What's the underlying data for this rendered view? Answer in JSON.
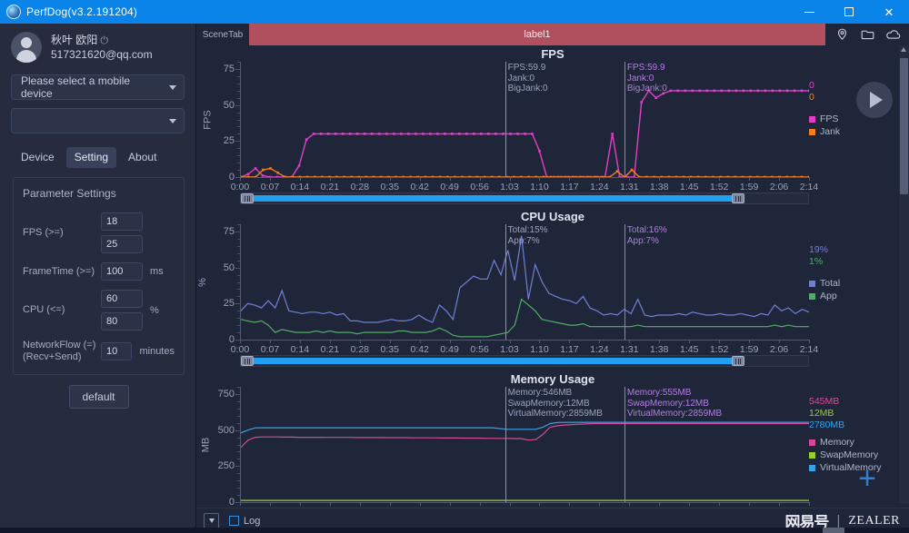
{
  "window": {
    "title": "PerfDog(v3.2.191204)",
    "app_icon": "perfdog-logo",
    "minimize": "–",
    "maximize": "▢",
    "close": "✕"
  },
  "sidebar": {
    "user": {
      "name": "秋叶 欧阳",
      "power_icon": "⏻",
      "email": "517321620@qq.com"
    },
    "device_select": {
      "value": "Please select a mobile device",
      "caret_icon": "chevron-down-icon"
    },
    "secondary_select": {
      "value": "",
      "caret_icon": "chevron-down-icon"
    },
    "tabs": [
      {
        "label": "Device",
        "active": false
      },
      {
        "label": "Setting",
        "active": true
      },
      {
        "label": "About",
        "active": false
      }
    ],
    "settings": {
      "title": "Parameter Settings",
      "fields": [
        {
          "label": "FPS (>=)",
          "values": [
            "18",
            "25"
          ],
          "unit": ""
        },
        {
          "label": "FrameTime (>=)",
          "values": [
            "100"
          ],
          "unit": "ms"
        },
        {
          "label": "CPU (<=)",
          "values": [
            "60",
            "80"
          ],
          "unit": "%"
        },
        {
          "label": "NetworkFlow (=)\n(Recv+Send)",
          "values": [
            "10"
          ],
          "unit": "minutes"
        }
      ],
      "default_button": "default"
    }
  },
  "scenebar": {
    "scene_tab": "SceneTab",
    "label": "label1",
    "icons": [
      "location-pin-icon",
      "folder-icon",
      "cloud-icon"
    ]
  },
  "bottom": {
    "dropdown_icon": "dropdown-icon",
    "log_label": "Log",
    "watermark_cn": "网易号",
    "watermark_sep": "|",
    "watermark_en": "ZEALER"
  },
  "controls": {
    "play_icon": "play-icon",
    "add_icon": "+"
  },
  "axis": {
    "xlabels": [
      "0:00",
      "0:07",
      "0:14",
      "0:21",
      "0:28",
      "0:35",
      "0:42",
      "0:49",
      "0:56",
      "1:03",
      "1:10",
      "1:17",
      "1:24",
      "1:31",
      "1:38",
      "1:45",
      "1:52",
      "1:59",
      "2:06",
      "2:14"
    ]
  },
  "chart_data": [
    {
      "type": "line",
      "title": "FPS",
      "xlabel": "",
      "ylabel": "FPS",
      "ylim": [
        0,
        80
      ],
      "yticks": [
        0,
        25,
        50,
        75
      ],
      "x": [
        "0:00",
        "2:14"
      ],
      "grid": false,
      "legend_position": "right",
      "series": [
        {
          "name": "FPS",
          "color": "#e040c8",
          "current": "0",
          "values": [
            0,
            2,
            6,
            1,
            0,
            0,
            0,
            0,
            8,
            26,
            30,
            30,
            30,
            30,
            30,
            30,
            30,
            30,
            30,
            30,
            30,
            30,
            30,
            30,
            30,
            30,
            30,
            30,
            30,
            30,
            30,
            30,
            30,
            30,
            30,
            30,
            30,
            30,
            30,
            30,
            30,
            18,
            0,
            0,
            0,
            0,
            0,
            0,
            0,
            0,
            0,
            30,
            0,
            0,
            0,
            52,
            59.9,
            55,
            58,
            59.9,
            59.9,
            59.9,
            59.9,
            59.9,
            59.9,
            59.9,
            59.9,
            59.9,
            59.9,
            59.9,
            59.9,
            59.9,
            59.9,
            59.9,
            59.9,
            59.9,
            59.9,
            59.9,
            59.9
          ]
        },
        {
          "name": "Jank",
          "color": "#f08020",
          "current": "0",
          "values": [
            0,
            0,
            0,
            5,
            6,
            3,
            0,
            0,
            0,
            0,
            0,
            0,
            0,
            0,
            0,
            0,
            0,
            0,
            0,
            0,
            0,
            0,
            0,
            0,
            0,
            0,
            0,
            0,
            0,
            0,
            0,
            0,
            0,
            0,
            0,
            0,
            0,
            0,
            0,
            0,
            0,
            0,
            0,
            0,
            0,
            0,
            0,
            0,
            0,
            0,
            0,
            4,
            0,
            5,
            0,
            0,
            0,
            0,
            0,
            0,
            0,
            0,
            0,
            0,
            0,
            0,
            0,
            0,
            0,
            0,
            0,
            0,
            0,
            0,
            0,
            0,
            0,
            0
          ]
        }
      ],
      "cursors": [
        {
          "side": "left",
          "x_pct": 46.5,
          "color": "#8e93a8",
          "lines": [
            "FPS:59.9",
            "Jank:0",
            "BigJank:0"
          ]
        },
        {
          "side": "right",
          "x_pct": 67.5,
          "color": "#a86fd4",
          "lines": [
            "FPS:59.9",
            "Jank:0",
            "BigJank:0"
          ]
        }
      ]
    },
    {
      "type": "line",
      "title": "CPU Usage",
      "xlabel": "",
      "ylabel": "%",
      "ylim": [
        0,
        80
      ],
      "yticks": [
        0,
        25,
        50,
        75
      ],
      "grid": false,
      "legend_position": "right",
      "series": [
        {
          "name": "Total",
          "color": "#6f7fd4",
          "current": "19%",
          "values": [
            20,
            25,
            24,
            22,
            27,
            22,
            34,
            20,
            19,
            18,
            19,
            19,
            18,
            19,
            17,
            18,
            13,
            13,
            12,
            12,
            12,
            13,
            14,
            13,
            13,
            14,
            17,
            14,
            12,
            24,
            20,
            14,
            36,
            40,
            44,
            42,
            42,
            55,
            45,
            62,
            41,
            72,
            28,
            52,
            40,
            32,
            30,
            28,
            27,
            25,
            30,
            22,
            20,
            17,
            18,
            17,
            21,
            18,
            28,
            17,
            16,
            17,
            17,
            17,
            18,
            17,
            19,
            18,
            17,
            17,
            18,
            17,
            17,
            18,
            17,
            16,
            18,
            17,
            24,
            20,
            22,
            18,
            21,
            19
          ]
        },
        {
          "name": "App",
          "color": "#4fae64",
          "current": "1%",
          "values": [
            14,
            13,
            12,
            13,
            10,
            5,
            7,
            6,
            5,
            5,
            5,
            6,
            5,
            6,
            5,
            5,
            5,
            4,
            5,
            5,
            5,
            5,
            5,
            6,
            6,
            5,
            5,
            5,
            6,
            8,
            6,
            3,
            2,
            2,
            2,
            2,
            2,
            3,
            4,
            5,
            10,
            28,
            24,
            20,
            14,
            13,
            12,
            11,
            10,
            10,
            11,
            9,
            9,
            9,
            9,
            9,
            9,
            9,
            10,
            9,
            9,
            9,
            9,
            9,
            9,
            9,
            9,
            9,
            9,
            9,
            9,
            9,
            9,
            9,
            9,
            9,
            9,
            9,
            10,
            9,
            10,
            9,
            9,
            9
          ]
        }
      ],
      "cursors": [
        {
          "side": "left",
          "x_pct": 46.5,
          "color": "#8e93a8",
          "lines": [
            "Total:15%",
            "App:7%"
          ]
        },
        {
          "side": "right",
          "x_pct": 67.5,
          "color": "#a86fd4",
          "lines": [
            "Total:16%",
            "App:7%"
          ]
        }
      ]
    },
    {
      "type": "line",
      "title": "Memory Usage",
      "xlabel": "",
      "ylabel": "MB",
      "ylim": [
        0,
        800
      ],
      "yticks": [
        0,
        250,
        500,
        750
      ],
      "grid": false,
      "legend_position": "right",
      "series": [
        {
          "name": "Memory",
          "color": "#d44a9a",
          "current": "545MB",
          "values": [
            380,
            430,
            450,
            452,
            452,
            452,
            451,
            451,
            450,
            450,
            450,
            450,
            449,
            449,
            449,
            449,
            448,
            448,
            448,
            448,
            447,
            447,
            447,
            447,
            446,
            446,
            446,
            446,
            445,
            445,
            445,
            444,
            444,
            444,
            443,
            443,
            442,
            442,
            441,
            440,
            430,
            434,
            470,
            520,
            530,
            535,
            538,
            540,
            543,
            545,
            545,
            545,
            545,
            545,
            545,
            545,
            545,
            545,
            545,
            545,
            545,
            545,
            545,
            545,
            545,
            545,
            545,
            545,
            545,
            545,
            545,
            545,
            545,
            545,
            545,
            545,
            545,
            545,
            545,
            545
          ]
        },
        {
          "name": "SwapMemory",
          "color": "#9acd32",
          "current": "12MB",
          "values": [
            12,
            12,
            12,
            12,
            12,
            12,
            12,
            12,
            12,
            12,
            12,
            12,
            12,
            12,
            12,
            12,
            12,
            12,
            12,
            12,
            12,
            12,
            12,
            12,
            12,
            12,
            12,
            12,
            12,
            12,
            12,
            12,
            12,
            12,
            12,
            12,
            12,
            12,
            12,
            12,
            12,
            12,
            12,
            12,
            12,
            12,
            12,
            12,
            12,
            12,
            12,
            12,
            12,
            12,
            12,
            12,
            12,
            12,
            12,
            12,
            12,
            12,
            12,
            12,
            12,
            12,
            12,
            12,
            12,
            12,
            12,
            12,
            12,
            12,
            12,
            12,
            12,
            12,
            12,
            12
          ]
        },
        {
          "name": "VirtualMemory",
          "color": "#3aa0e8",
          "current": "2780MB",
          "values": [
            480,
            500,
            515,
            516,
            516,
            516,
            516,
            516,
            516,
            516,
            516,
            516,
            516,
            516,
            516,
            516,
            516,
            516,
            516,
            516,
            516,
            516,
            516,
            516,
            516,
            516,
            516,
            516,
            516,
            516,
            516,
            516,
            516,
            516,
            516,
            516,
            510,
            505,
            505,
            505,
            505,
            505,
            520,
            545,
            552,
            553,
            554,
            554,
            554,
            554,
            554,
            554,
            554,
            554,
            554,
            554,
            554,
            554,
            554,
            554,
            554,
            554,
            554,
            554,
            554,
            554,
            554,
            554,
            554,
            554,
            554,
            554,
            554,
            554,
            554,
            554,
            554,
            554,
            554,
            554
          ]
        }
      ],
      "cursors": [
        {
          "side": "left",
          "x_pct": 46.5,
          "color": "#8e93a8",
          "lines": [
            "Memory:546MB",
            "SwapMemory:12MB",
            "VirtualMemory:2859MB"
          ]
        },
        {
          "side": "right",
          "x_pct": 67.5,
          "color": "#a86fd4",
          "lines": [
            "Memory:555MB",
            "SwapMemory:12MB",
            "VirtualMemory:2859MB"
          ]
        }
      ]
    }
  ]
}
